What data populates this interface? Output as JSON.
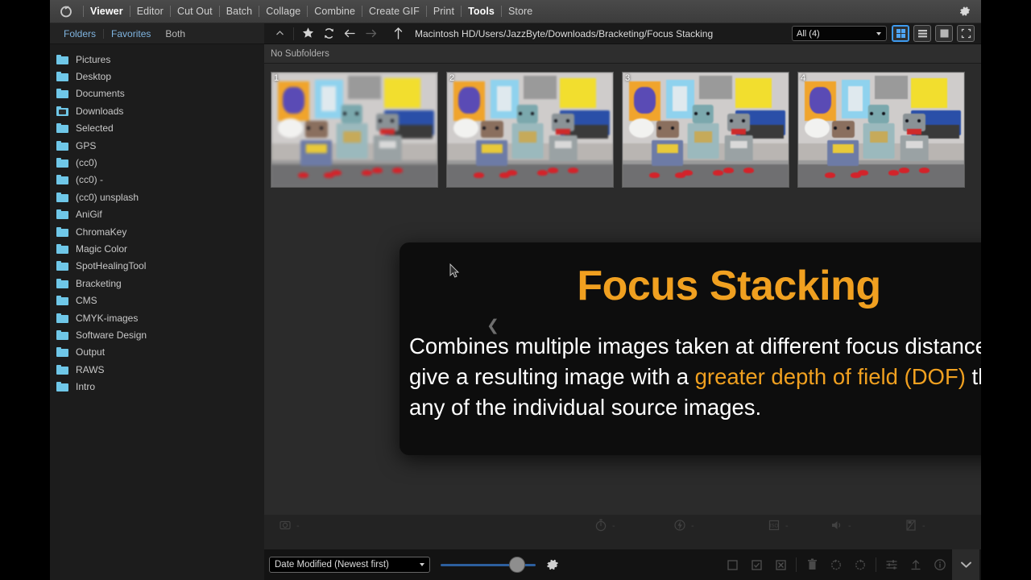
{
  "app": {
    "logo_icon": "lens-logo-icon",
    "settings_icon": "gear-icon"
  },
  "menubar": {
    "items": [
      {
        "label": "Viewer",
        "active": true
      },
      {
        "label": "Editor",
        "active": false
      },
      {
        "label": "Cut Out",
        "active": false
      },
      {
        "label": "Batch",
        "active": false
      },
      {
        "label": "Collage",
        "active": false
      },
      {
        "label": "Combine",
        "active": false
      },
      {
        "label": "Create GIF",
        "active": false
      },
      {
        "label": "Print",
        "active": false
      },
      {
        "label": "Tools",
        "active": true
      },
      {
        "label": "Store",
        "active": false
      }
    ]
  },
  "sidebar": {
    "tabs": [
      {
        "label": "Folders",
        "style": "link"
      },
      {
        "label": "Favorites",
        "style": "link"
      },
      {
        "label": "Both",
        "style": "muted"
      }
    ],
    "folders": [
      {
        "label": "Pictures",
        "icon": "folder-icon"
      },
      {
        "label": "Desktop",
        "icon": "folder-icon"
      },
      {
        "label": "Documents",
        "icon": "folder-icon"
      },
      {
        "label": "Downloads",
        "icon": "folder-open-icon"
      },
      {
        "label": "Selected",
        "icon": "folder-icon"
      },
      {
        "label": "GPS",
        "icon": "folder-icon"
      },
      {
        "label": "(cc0)",
        "icon": "folder-icon"
      },
      {
        "label": "(cc0) -",
        "icon": "folder-icon"
      },
      {
        "label": "(cc0) unsplash",
        "icon": "folder-icon"
      },
      {
        "label": "AniGif",
        "icon": "folder-icon"
      },
      {
        "label": "ChromaKey",
        "icon": "folder-icon"
      },
      {
        "label": "Magic Color",
        "icon": "folder-icon"
      },
      {
        "label": "SpotHealingTool",
        "icon": "folder-icon"
      },
      {
        "label": "Bracketing",
        "icon": "folder-icon"
      },
      {
        "label": "CMS",
        "icon": "folder-icon"
      },
      {
        "label": "CMYK-images",
        "icon": "folder-icon"
      },
      {
        "label": "Software Design",
        "icon": "folder-icon"
      },
      {
        "label": "Output",
        "icon": "folder-icon"
      },
      {
        "label": "RAWS",
        "icon": "folder-icon"
      },
      {
        "label": "Intro",
        "icon": "folder-icon"
      }
    ]
  },
  "pathbar": {
    "collapse_icon": "chevron-up-icon",
    "favorite_icon": "star-icon",
    "refresh_icon": "refresh-icon",
    "back_icon": "arrow-left-icon",
    "forward_icon": "arrow-right-icon",
    "up_icon": "arrow-up-icon",
    "path": "Macintosh HD/Users/JazzByte/Downloads/Bracketing/Focus Stacking",
    "filter_value": "All (4)",
    "views": [
      {
        "name": "grid-view-button",
        "icon": "grid-icon",
        "active": true
      },
      {
        "name": "list-view-button",
        "icon": "list-icon",
        "active": false
      },
      {
        "name": "single-view-button",
        "icon": "single-image-icon",
        "active": false
      },
      {
        "name": "fullscreen-view-button",
        "icon": "fullscreen-icon",
        "active": false
      }
    ]
  },
  "subfolder_bar": {
    "text": "No Subfolders"
  },
  "thumbnails": [
    {
      "number": "1"
    },
    {
      "number": "2"
    },
    {
      "number": "3"
    },
    {
      "number": "4"
    }
  ],
  "overlay": {
    "title": "Focus Stacking",
    "body_part1": "Combines multiple images taken at different focus distances to give a resulting image with a ",
    "body_accent": "greater depth of field (DOF)",
    "body_part2": " than any of the individual source images.",
    "prev_icon": "chevron-left-icon",
    "title_color": "#f0a020",
    "accent_color": "#f0a020",
    "background_color": "#0d0d0d"
  },
  "exif_bar": {
    "items": [
      {
        "icon": "aperture-icon",
        "value": "-"
      },
      {
        "icon": "shutter-speed-icon",
        "value": "-"
      },
      {
        "icon": "flash-icon",
        "value": "-"
      },
      {
        "icon": "iso-icon",
        "value": "-"
      },
      {
        "icon": "sound-icon",
        "value": "-"
      },
      {
        "icon": "exposure-icon",
        "value": "-"
      }
    ]
  },
  "bottom_bar": {
    "sort_value": "Date Modified (Newest first)",
    "zoom_slider_percent": 72,
    "settings_icon": "gear-icon",
    "actions": [
      {
        "name": "select-none-button",
        "icon": "square-icon"
      },
      {
        "name": "select-all-button",
        "icon": "checked-square-icon"
      },
      {
        "name": "deselect-button",
        "icon": "crossed-square-icon"
      },
      {
        "name": "delete-button",
        "icon": "trash-icon"
      },
      {
        "name": "rotate-left-button",
        "icon": "rotate-left-icon"
      },
      {
        "name": "rotate-right-button",
        "icon": "rotate-right-icon"
      },
      {
        "name": "adjust-button",
        "icon": "sliders-icon"
      },
      {
        "name": "export-button",
        "icon": "upload-icon"
      },
      {
        "name": "info-button",
        "icon": "info-icon"
      }
    ],
    "expand_icon": "chevron-down-icon"
  }
}
